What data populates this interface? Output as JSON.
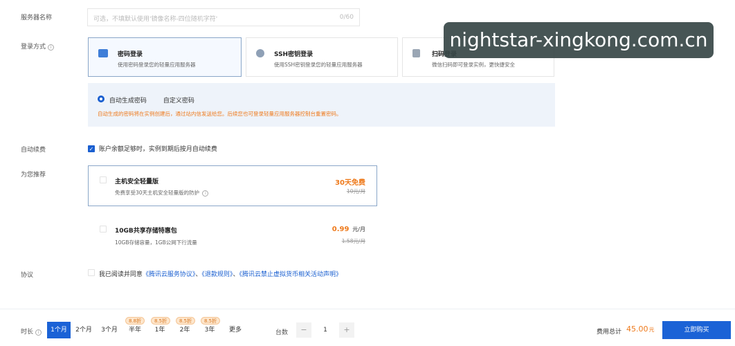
{
  "form": {
    "server_name": {
      "label": "服务器名称",
      "placeholder": "可选，不填默认使用'镜像名称-四位随机字符'",
      "counter": "0/60"
    },
    "login": {
      "label": "登录方式",
      "options": [
        {
          "title": "密码登录",
          "desc": "使用密码登录您的轻量应用服务器",
          "icon": "password-login-icon"
        },
        {
          "title": "SSH密钥登录",
          "desc": "使用SSH密钥登录您的轻量应用服务器",
          "icon": "ssh-key-icon"
        },
        {
          "title": "扫码登录",
          "desc": "微信扫码即可登录实例，更快捷安全",
          "icon": "qr-scan-icon"
        }
      ],
      "pw_auto": "自动生成密码",
      "pw_custom": "自定义密码",
      "hint": "自动生成的密码将在实例创建后，通过站内信发送给您。后续您也可登录轻量应用服务器控制台重置密码。"
    },
    "renew": {
      "label": "自动续费",
      "text": "账户余额足够时，实例到期后按月自动续费"
    },
    "recommend": {
      "label": "为您推荐",
      "items": [
        {
          "title": "主机安全轻量版",
          "desc": "免费享受30天主机安全轻量版的防护",
          "price": "30天免费",
          "original": "10元/月"
        },
        {
          "title": "10GB共享存储特惠包",
          "desc": "10GB存储容量，1GB公网下行流量",
          "price": "0.99",
          "unit": "元/月",
          "original": "1.58元/月"
        }
      ]
    },
    "agreement": {
      "label": "协议",
      "prefix": "我已阅读并同意",
      "link1": "《腾讯云服务协议》",
      "sep1": "、",
      "link2": "《退款规则》",
      "sep2": "、",
      "link3": "《腾讯云禁止虚拟货币相关活动声明》"
    }
  },
  "footer": {
    "duration_label": "时长",
    "durations": [
      "1个月",
      "2个月",
      "3个月",
      "半年",
      "1年",
      "2年",
      "3年",
      "更多"
    ],
    "discounts": [
      "8.8折",
      "8.5折",
      "8.5折",
      "8.5折"
    ],
    "quantity_label": "台数",
    "quantity": "1",
    "minus": "−",
    "plus": "+",
    "total_label": "费用总计",
    "total_value": "45.00",
    "total_unit": "元",
    "buy_label": "立即购买"
  },
  "watermark": "nightstar-xingkong.com.cn",
  "colors": {
    "accent": "#1b62d6",
    "orange": "#ee7a1c",
    "link": "#1a5fd0"
  }
}
